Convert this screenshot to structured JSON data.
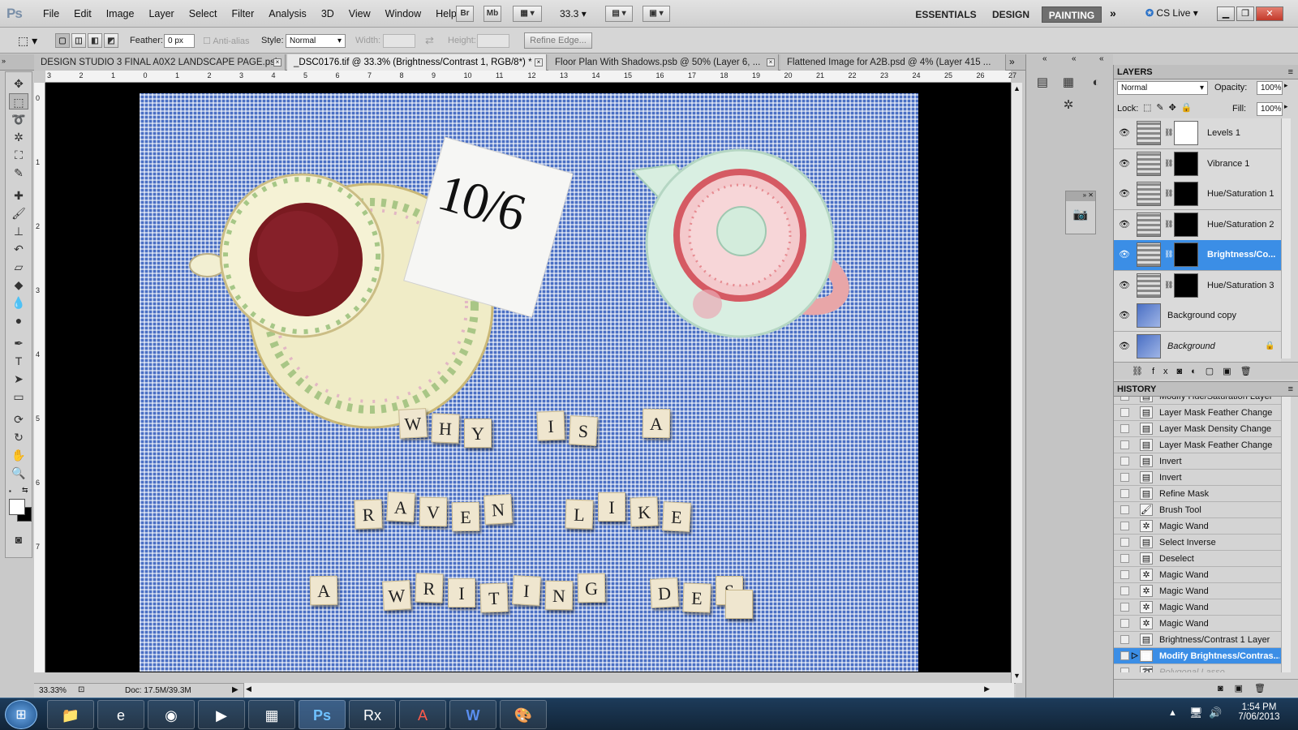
{
  "app": {
    "logo": "Ps"
  },
  "menubar": {
    "items": [
      "File",
      "Edit",
      "Image",
      "Layer",
      "Select",
      "Filter",
      "Analysis",
      "3D",
      "View",
      "Window",
      "Help"
    ],
    "bridge_label": "Br",
    "minibridge_label": "Mb",
    "zoom_value": "33.3",
    "workspaces": [
      "ESSENTIALS",
      "DESIGN",
      "PAINTING"
    ],
    "active_workspace": "PAINTING",
    "cslive_label": "CS Live"
  },
  "options": {
    "feather_label": "Feather:",
    "feather_value": "0 px",
    "antialias_label": "Anti-alias",
    "style_label": "Style:",
    "style_value": "Normal",
    "width_label": "Width:",
    "height_label": "Height:",
    "refine_edge_label": "Refine Edge..."
  },
  "tabs": [
    {
      "label": "DESIGN STUDIO 3 FINAL A0X2 LANDSCAPE PAGE.psb",
      "active": false
    },
    {
      "label": "_DSC0176.tif @ 33.3% (Brightness/Contrast 1, RGB/8*) *",
      "active": true
    },
    {
      "label": "Floor Plan With Shadows.psb @ 50% (Layer 6, ...",
      "active": false
    },
    {
      "label": "Flattened Image for A2B.psd @ 4% (Layer 415 ...",
      "active": false
    }
  ],
  "ruler": {
    "top_numbers": [
      "3",
      "2",
      "1",
      "0",
      "1",
      "2",
      "3",
      "4",
      "5",
      "6",
      "7",
      "8",
      "9",
      "10",
      "11",
      "12",
      "13",
      "14",
      "15",
      "16",
      "17",
      "18",
      "19",
      "20",
      "21",
      "22",
      "23",
      "24",
      "25",
      "26",
      "27"
    ],
    "left_numbers": [
      "0",
      "1",
      "2",
      "3",
      "4",
      "5",
      "6",
      "7"
    ]
  },
  "canvas": {
    "card_text": "10/6",
    "tile_rows": [
      [
        "W",
        "H",
        "Y",
        "I",
        "S",
        "A"
      ],
      [
        "R",
        "A",
        "V",
        "E",
        "N",
        "L",
        "I",
        "K",
        "E"
      ],
      [
        "A",
        "W",
        "R",
        "I",
        "T",
        "I",
        "N",
        "G",
        "D",
        "E",
        "S"
      ]
    ]
  },
  "status": {
    "zoom": "33.33%",
    "doc_info": "Doc: 17.5M/39.3M"
  },
  "layers_panel": {
    "title": "LAYERS",
    "blend_mode": "Normal",
    "opacity_label": "Opacity:",
    "opacity_value": "100%",
    "lock_label": "Lock:",
    "fill_label": "Fill:",
    "fill_value": "100%",
    "layers": [
      {
        "name": "Levels 1",
        "selected": false,
        "mask": "white"
      },
      {
        "name": "Vibrance 1",
        "selected": false,
        "mask": "black"
      },
      {
        "name": "Hue/Saturation 1",
        "selected": false,
        "mask": "black"
      },
      {
        "name": "Hue/Saturation 2",
        "selected": false,
        "mask": "black"
      },
      {
        "name": "Brightness/Co...",
        "selected": true,
        "mask": "black"
      },
      {
        "name": "Hue/Saturation 3",
        "selected": false,
        "mask": "black"
      },
      {
        "name": "Background copy",
        "selected": false,
        "mask": ""
      },
      {
        "name": "Background",
        "selected": false,
        "mask": "",
        "locked": true
      }
    ]
  },
  "history_panel": {
    "title": "HISTORY",
    "items": [
      {
        "label": "Modify Hue/Saturation Layer",
        "state": "past"
      },
      {
        "label": "Layer Mask Feather Change",
        "state": "past"
      },
      {
        "label": "Layer Mask Density Change",
        "state": "past"
      },
      {
        "label": "Layer Mask Feather Change",
        "state": "past"
      },
      {
        "label": "Invert",
        "state": "past"
      },
      {
        "label": "Invert",
        "state": "past"
      },
      {
        "label": "Refine Mask",
        "state": "past"
      },
      {
        "label": "Brush Tool",
        "state": "past"
      },
      {
        "label": "Magic Wand",
        "state": "past"
      },
      {
        "label": "Select Inverse",
        "state": "past"
      },
      {
        "label": "Deselect",
        "state": "past"
      },
      {
        "label": "Magic Wand",
        "state": "past"
      },
      {
        "label": "Magic Wand",
        "state": "past"
      },
      {
        "label": "Magic Wand",
        "state": "past"
      },
      {
        "label": "Magic Wand",
        "state": "past"
      },
      {
        "label": "Brightness/Contrast 1 Layer",
        "state": "past"
      },
      {
        "label": "Modify Brightness/Contras...",
        "state": "current"
      },
      {
        "label": "Polygonal Lasso",
        "state": "future"
      }
    ]
  },
  "taskbar": {
    "time": "1:54 PM",
    "date": "7/06/2013"
  },
  "colors": {
    "selection": "#3b8ee6",
    "cloth": "#4a6fc4",
    "canvas_bg": "#000000"
  }
}
